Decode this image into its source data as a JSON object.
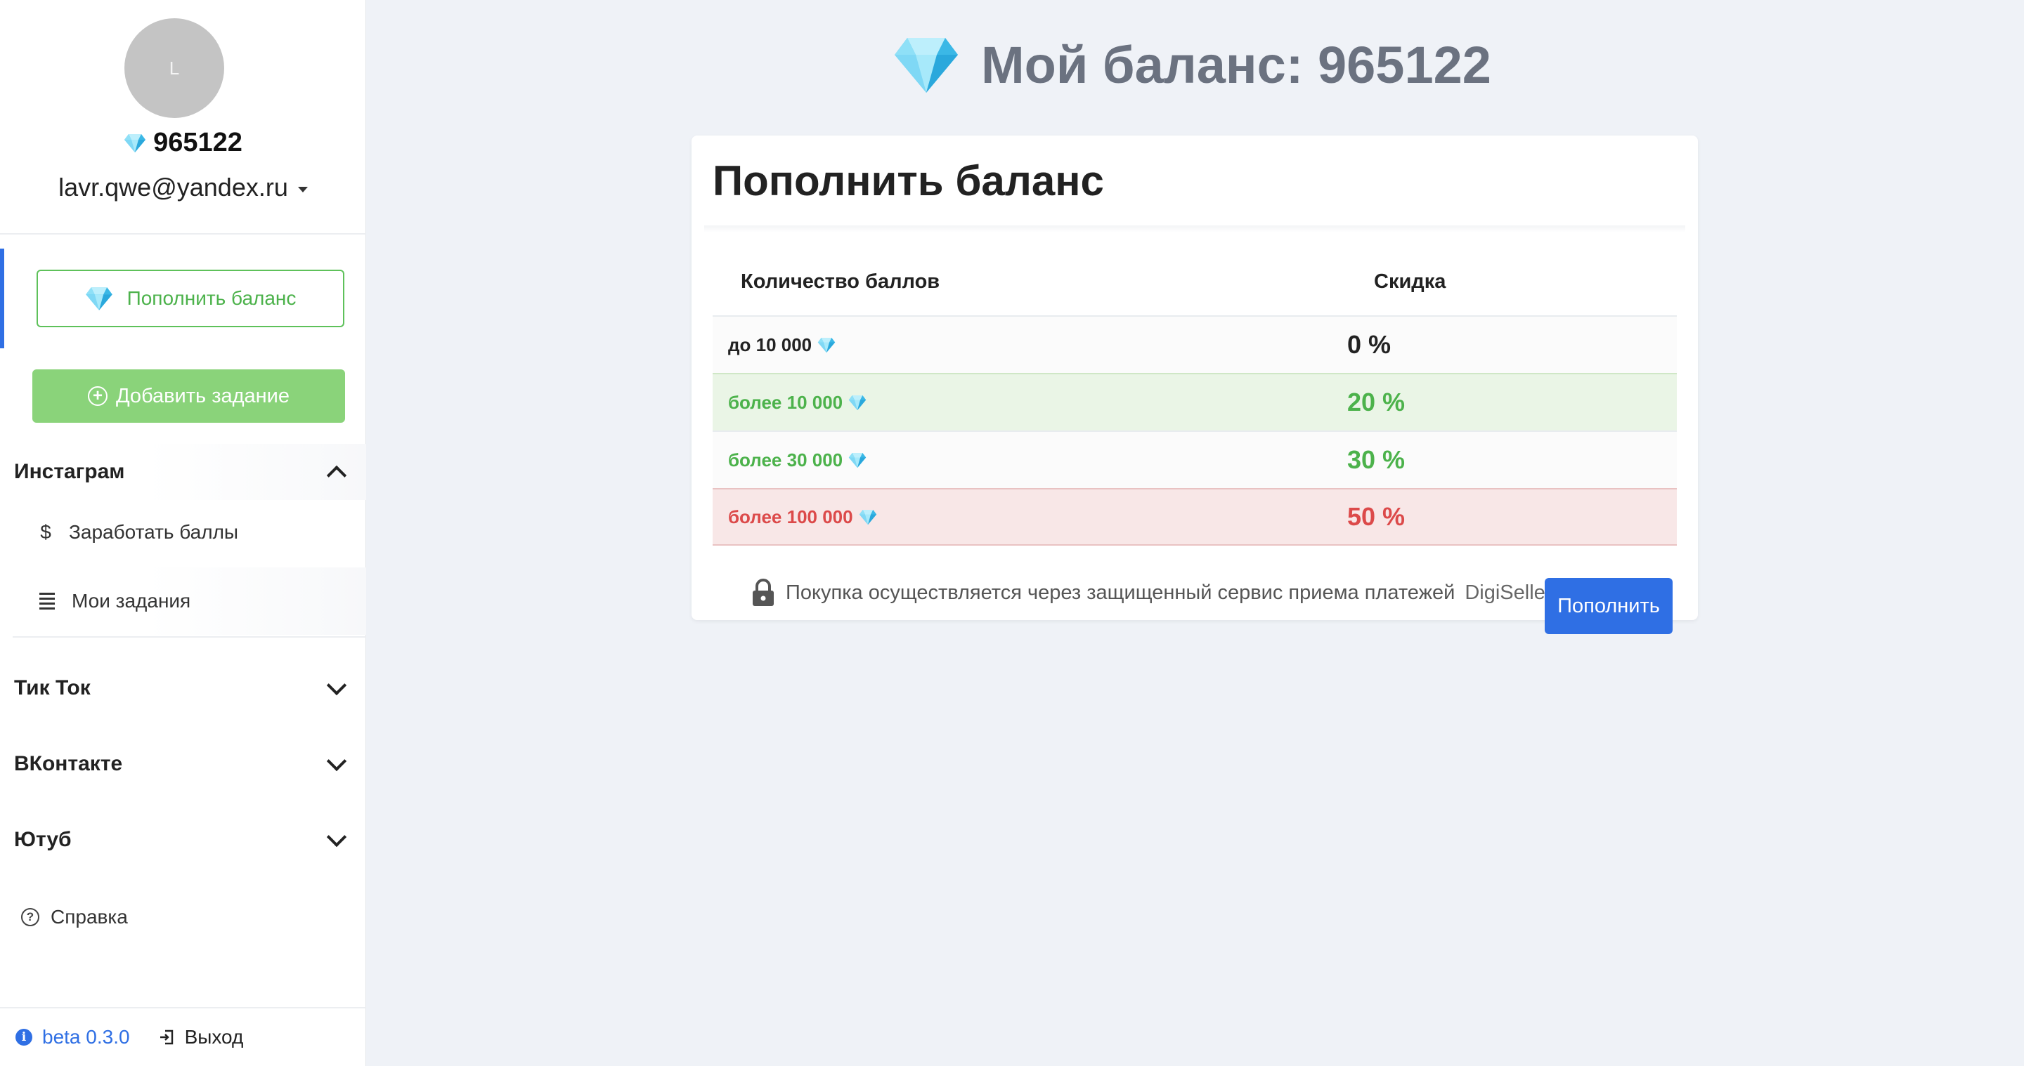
{
  "user": {
    "avatar_letter": "L",
    "balance": "965122",
    "email": "lavr.qwe@yandex.ru"
  },
  "sidebar": {
    "topup_label": "Пополнить баланс",
    "add_task_label": "Добавить задание",
    "sections": [
      {
        "label": "Инстаграм",
        "expanded": true,
        "items": [
          {
            "label": "Заработать баллы",
            "icon": "dollar-icon"
          },
          {
            "label": "Мои задания",
            "icon": "list-icon"
          }
        ]
      },
      {
        "label": "Тик Ток",
        "expanded": false
      },
      {
        "label": "ВКонтакте",
        "expanded": false
      },
      {
        "label": "Ютуб",
        "expanded": false
      }
    ],
    "help_label": "Справка",
    "version_label": "beta 0.3.0",
    "logout_label": "Выход"
  },
  "main": {
    "balance_title": "Мой баланс: 965122",
    "card_title": "Пополнить баланс",
    "table": {
      "headers": [
        "Количество баллов",
        "Скидка"
      ],
      "rows": [
        {
          "qty": "до 10 000",
          "discount": "0 %",
          "style": "default"
        },
        {
          "qty": "более 10 000",
          "discount": "20 %",
          "style": "green-highlight"
        },
        {
          "qty": "более 30 000",
          "discount": "30 %",
          "style": "green"
        },
        {
          "qty": "более 100 000",
          "discount": "50 %",
          "style": "red-highlight"
        }
      ]
    },
    "payment_note": "Покупка осуществляется через защищенный сервис приема платежей",
    "payment_vendor": "DigiSeller",
    "pay_button": "Пополнить"
  },
  "colors": {
    "accent_blue": "#2f6fe4",
    "green": "#4cb24b",
    "green_button": "#8ad37a",
    "red": "#dc4a4a",
    "background": "#eff2f7"
  }
}
